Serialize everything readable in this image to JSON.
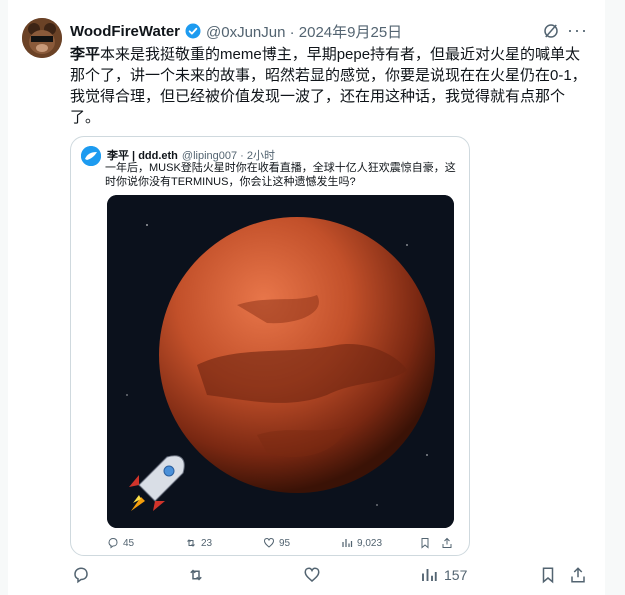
{
  "post": {
    "display_name": "WoodFireWater",
    "handle_and_date": "@0xJunJun · 2024年9月25日",
    "text_bold": "李平",
    "text_rest": "本来是我挺敬重的meme博主，早期pepe持有者，但最近对火星的喊单太那个了，讲一个未来的故事，昭然若显的感觉，你要是说现在在火星仍在0-1，我觉得合理，但已经被价值发现一波了，还在用这种话，我觉得就有点那个了。",
    "more_label": "···"
  },
  "quote": {
    "display_name": "李平 | ddd.eth",
    "handle_and_time": "@liping007 · 2小时",
    "text": "一年后，MUSK登陆火星时你在收看直播，全球十亿人狂欢震惊自豪，这时你说你没有TERMINUS，你会让这种遗憾发生吗?",
    "replies": "45",
    "reposts": "23",
    "likes": "95",
    "views": "9,023"
  },
  "actions": {
    "views": "157"
  },
  "colors": {
    "verified": "#1d9bf0",
    "muted": "#536471",
    "mars": "#c2502a"
  }
}
